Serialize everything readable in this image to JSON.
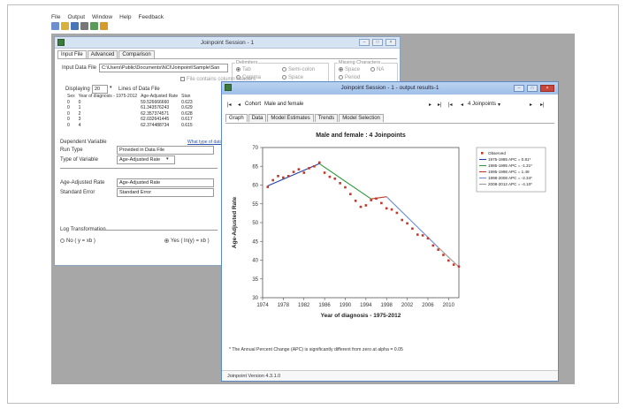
{
  "menu": [
    "File",
    "Output",
    "Window",
    "Help",
    "Feedback"
  ],
  "toolbar": {
    "icons": [
      "new-file-icon",
      "open-folder-icon",
      "save-icon",
      "print-icon",
      "copy-icon",
      "warning-icon"
    ],
    "colors": [
      "#6e8fcf",
      "#d7b13c",
      "#4a74b8",
      "#777777",
      "#5a9a5a",
      "#d69a2a"
    ]
  },
  "main_window": {
    "title": "Joinpoint Session - 1",
    "tabs": [
      "Input File",
      "Advanced",
      "Comparison"
    ],
    "input_data_file_label": "Input Data File",
    "input_data_file_value": "C:\\Users\\Public\\Documents\\NCI\\Joinpoint\\Sample\\San",
    "delimiters_title": "Delimiters",
    "delimiters": [
      "Tab",
      "Semi-colon",
      "Comma",
      "Space"
    ],
    "missing_title": "Missing Characters",
    "missing": [
      "Space",
      "NA",
      "Period"
    ],
    "file_has_headers": "File contains column headers",
    "displaying_label": "Displaying",
    "displaying_value": "20",
    "lines_label": "Lines of Data File",
    "table_headers": [
      "Sex",
      "Year of diagnosis - 1975-2012",
      "Age-Adjusted Rate",
      "Stan"
    ],
    "table_rows": [
      [
        "0",
        "0",
        "59.526666660",
        "0.623"
      ],
      [
        "0",
        "1",
        "61.343576243",
        "0.629"
      ],
      [
        "0",
        "2",
        "62.357374571",
        "0.628"
      ],
      [
        "0",
        "3",
        "62.032641445",
        "0.617"
      ],
      [
        "0",
        "4",
        "62.374488734",
        "0.615"
      ]
    ],
    "dependent_variable": "Dependent Variable",
    "what_type_link": "What type of data do I have?",
    "run_type_label": "Run Type",
    "run_type_value": "Provided in Data File",
    "type_variable_label": "Type of Variable",
    "type_variable_value": "Age-Adjusted Rate",
    "age_adjusted_label": "Age-Adjusted Rate",
    "age_adjusted_value": "Age-Adjusted Rate",
    "standard_error_label": "Standard Error",
    "standard_error_value": "Standard Error",
    "log_transformation": "Log Transformation",
    "log_no": "No  ( y = xb )",
    "log_yes": "Yes  ( ln(y) = xb )"
  },
  "output_window": {
    "title": "Joinpoint Session - 1 - output results-1",
    "cohort_label": "Cohort",
    "cohort_value": "Male and female",
    "joinpoints_value": "4 Joinpoints",
    "tabs": [
      "Graph",
      "Data",
      "Model Estimates",
      "Trends",
      "Model Selection"
    ],
    "footnote": "* The Annual Percent Change (APC) is significantly different from zero at alpha = 0.05",
    "version": "Joinpoint Version 4.3.1.0"
  },
  "chart_data": {
    "type": "line",
    "title": "Male and female : 4 Joinpoints",
    "xlabel": "Year of diagnosis - 1975-2012",
    "ylabel": "Age-Adjusted Rate",
    "xlim": [
      1974,
      2012
    ],
    "ylim": [
      30,
      70
    ],
    "x_ticks": [
      1974,
      1978,
      1982,
      1986,
      1990,
      1994,
      1998,
      2002,
      2006,
      2010
    ],
    "y_ticks": [
      30,
      35,
      40,
      45,
      50,
      55,
      60,
      65,
      70
    ],
    "grid": false,
    "legend_position": "top-right",
    "observed": {
      "name": "Observed",
      "color": "#c0392b",
      "x": [
        1975,
        1976,
        1977,
        1978,
        1979,
        1980,
        1981,
        1982,
        1983,
        1984,
        1985,
        1986,
        1987,
        1988,
        1989,
        1990,
        1991,
        1992,
        1993,
        1994,
        1995,
        1996,
        1997,
        1998,
        1999,
        2000,
        2001,
        2002,
        2003,
        2004,
        2005,
        2006,
        2007,
        2008,
        2009,
        2010,
        2011,
        2012
      ],
      "y": [
        59.5,
        61.3,
        62.4,
        62.0,
        62.4,
        63.5,
        64.2,
        63.3,
        64.5,
        65.0,
        66.0,
        63.3,
        62.2,
        61.7,
        60.5,
        59.4,
        57.6,
        55.8,
        54.2,
        54.6,
        56.0,
        56.4,
        55.2,
        53.8,
        53.5,
        52.6,
        50.7,
        49.8,
        48.4,
        46.8,
        46.6,
        45.8,
        43.9,
        42.8,
        41.4,
        39.9,
        38.8,
        38.3
      ]
    },
    "series": [
      {
        "name": "1975-1985 APC = 0.81*",
        "color": "#1f3fa8",
        "x": [
          1975,
          1985
        ],
        "y": [
          59.8,
          65.7
        ]
      },
      {
        "name": "1985-1995 APC = -1.31*",
        "color": "#2e9a3a",
        "x": [
          1985,
          1995
        ],
        "y": [
          65.7,
          56.3
        ]
      },
      {
        "name": "1995-1998 APC = 1.49",
        "color": "#c0392b",
        "x": [
          1995,
          1998
        ],
        "y": [
          56.3,
          56.9
        ]
      },
      {
        "name": "1998-2008 APC = -2.34*",
        "color": "#6b8fd6",
        "x": [
          1998,
          2008
        ],
        "y": [
          56.9,
          43.4
        ]
      },
      {
        "name": "2008-2012 APC = -4.10*",
        "color": "#9b9b9b",
        "x": [
          2008,
          2012
        ],
        "y": [
          43.4,
          38.2
        ]
      }
    ]
  }
}
